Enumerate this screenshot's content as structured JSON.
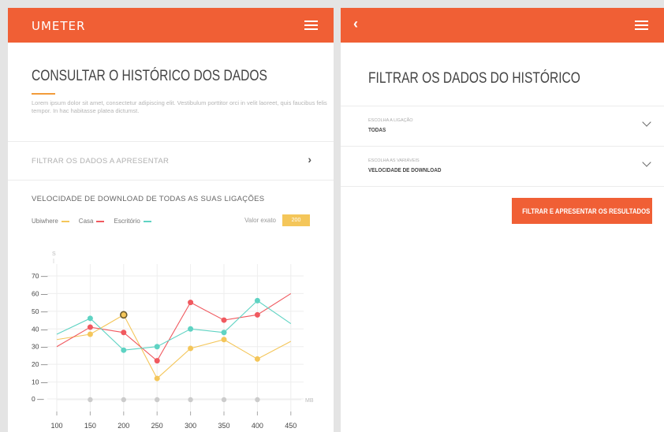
{
  "left": {
    "brand": "UMETER",
    "title": "CONSULTAR O HISTÓRICO DOS DADOS",
    "intro": "Lorem ipsum dolor sit amet, consectetur adipiscing elit. Vestibulum porttitor orci in velit laoreet, quis faucibus felis tempor. In hac habitasse platea dictumst.",
    "filter_label": "FILTRAR OS DADOS A APRESENTAR",
    "chart_title": "VELOCIDADE DE DOWNLOAD DE TODAS AS SUAS LIGAÇÕES",
    "legend": [
      {
        "name": "Ubiwhere",
        "color": "#f4c65a"
      },
      {
        "name": "Casa",
        "color": "#f0595f"
      },
      {
        "name": "Escritório",
        "color": "#5fd3c3"
      }
    ],
    "exact_label": "Valor exato",
    "exact_value": "200"
  },
  "right": {
    "title": "FILTRAR OS DADOS DO HISTÓRICO",
    "dropdowns": [
      {
        "label": "Escolha a ligação",
        "value": "TODAS"
      },
      {
        "label": "Escolha as variáveis",
        "value": "VELOCIDADE DE DOWNLOAD"
      }
    ],
    "apply_label": "FILTRAR E APRESENTAR OS RESULTADOS"
  },
  "icons": {
    "menu": "hamburger-icon",
    "back": "chevron-left-icon",
    "expand": "chevron-down-icon",
    "go": "chevron-right-icon"
  },
  "colors": {
    "accent": "#f05f35",
    "grid": "#ececec",
    "axis_marker": "#cccccc"
  },
  "chart_data": {
    "type": "line",
    "title": "VELOCIDADE DE DOWNLOAD DE TODAS AS SUAS LIGAÇÕES",
    "xlabel": "MB",
    "ylabel": "S",
    "ylim": [
      0,
      70
    ],
    "xlim": [
      100,
      450
    ],
    "x_ticks": [
      100,
      150,
      200,
      250,
      300,
      350,
      400,
      450
    ],
    "y_ticks": [
      0,
      10,
      20,
      30,
      40,
      50,
      60,
      70
    ],
    "grid": true,
    "legend_position": "top-left",
    "x_markers": [
      150,
      200,
      250,
      300,
      350,
      400
    ],
    "selected": {
      "series": "Ubiwhere",
      "x": 200,
      "y": 48
    },
    "series": [
      {
        "name": "Ubiwhere",
        "color": "#f4c65a",
        "x": [
          100,
          150,
          200,
          250,
          300,
          350,
          400,
          450
        ],
        "y": [
          34,
          37,
          48,
          12,
          29,
          34,
          23,
          33
        ]
      },
      {
        "name": "Casa",
        "color": "#f0595f",
        "x": [
          100,
          150,
          200,
          250,
          300,
          350,
          400,
          450
        ],
        "y": [
          30,
          41,
          38,
          22,
          55,
          45,
          48,
          60
        ]
      },
      {
        "name": "Escritório",
        "color": "#5fd3c3",
        "x": [
          100,
          150,
          200,
          250,
          300,
          350,
          400,
          450
        ],
        "y": [
          37,
          46,
          28,
          30,
          40,
          38,
          56,
          43
        ]
      }
    ]
  }
}
